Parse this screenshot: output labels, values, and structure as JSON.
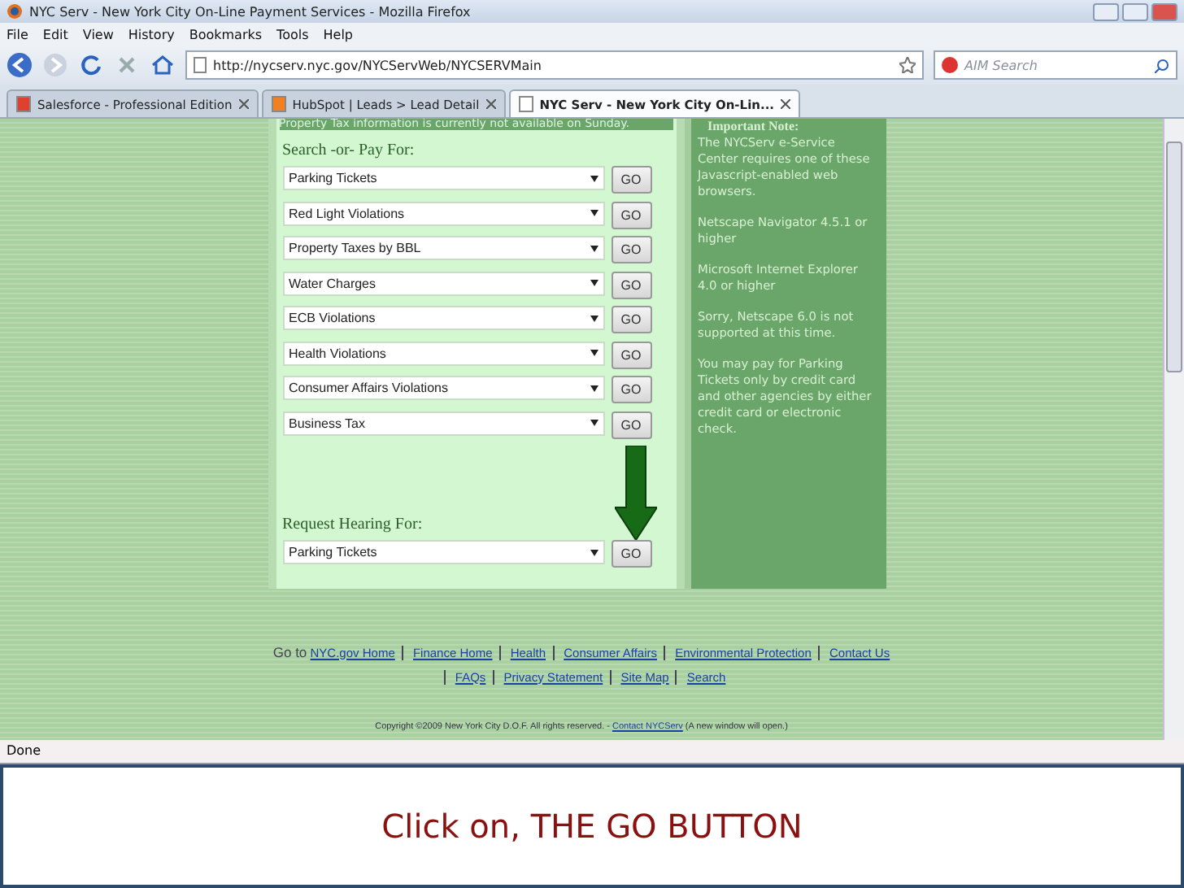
{
  "window": {
    "title": "NYC Serv - New York City On-Line Payment Services - Mozilla Firefox"
  },
  "menu": [
    "File",
    "Edit",
    "View",
    "History",
    "Bookmarks",
    "Tools",
    "Help"
  ],
  "address": {
    "value": "http://nycserv.nyc.gov/NYCServWeb/NYCSERVMain"
  },
  "search": {
    "placeholder": "AIM Search"
  },
  "tabs": [
    {
      "label": "Salesforce - Professional Edition",
      "selected": false
    },
    {
      "label": "HubSpot | Leads > Lead Detail",
      "selected": false
    },
    {
      "label": "NYC Serv - New York City On-Lin...",
      "selected": true
    }
  ],
  "notice": "Property Tax information is currently not available on Sunday.",
  "pay_heading": "Search -or- Pay For:",
  "pay_items": [
    {
      "value": "Parking Tickets",
      "button": "GO"
    },
    {
      "value": "Red Light Violations",
      "button": "GO"
    },
    {
      "value": "Property Taxes by BBL",
      "button": "GO"
    },
    {
      "value": "Water Charges",
      "button": "GO"
    },
    {
      "value": "ECB Violations",
      "button": "GO"
    },
    {
      "value": "Health Violations",
      "button": "GO"
    },
    {
      "value": "Consumer Affairs Violations",
      "button": "GO"
    },
    {
      "value": "Business Tax",
      "button": "GO"
    }
  ],
  "hearing_heading": "Request Hearing For:",
  "hearing_items": [
    {
      "value": "Parking Tickets",
      "button": "GO"
    }
  ],
  "note": {
    "title": "Important Note:",
    "paragraphs": [
      "The NYCServ e-Service Center requires one of these Javascript-enabled web browsers.",
      "Netscape Navigator 4.5.1 or higher",
      "Microsoft Internet Explorer 4.0 or higher",
      "Sorry, Netscape 6.0 is not supported at this time.",
      "You may pay for Parking Tickets only by credit card and other agencies by either credit card or electronic check."
    ]
  },
  "footer": {
    "label": "Go to",
    "links": [
      "NYC.gov Home",
      "Finance Home",
      "Health",
      "Consumer Affairs",
      "Environmental Protection",
      "Contact Us",
      "FAQs",
      "Privacy Statement",
      "Site Map",
      "Search"
    ],
    "copyright": "Copyright ©2009 New York City D.O.F. All rights reserved. -",
    "contact_link": "Contact NYCServ",
    "contact_note": "(A new window will open.)"
  },
  "status_bar": "Done",
  "caption": "Click on, THE GO BUTTON"
}
